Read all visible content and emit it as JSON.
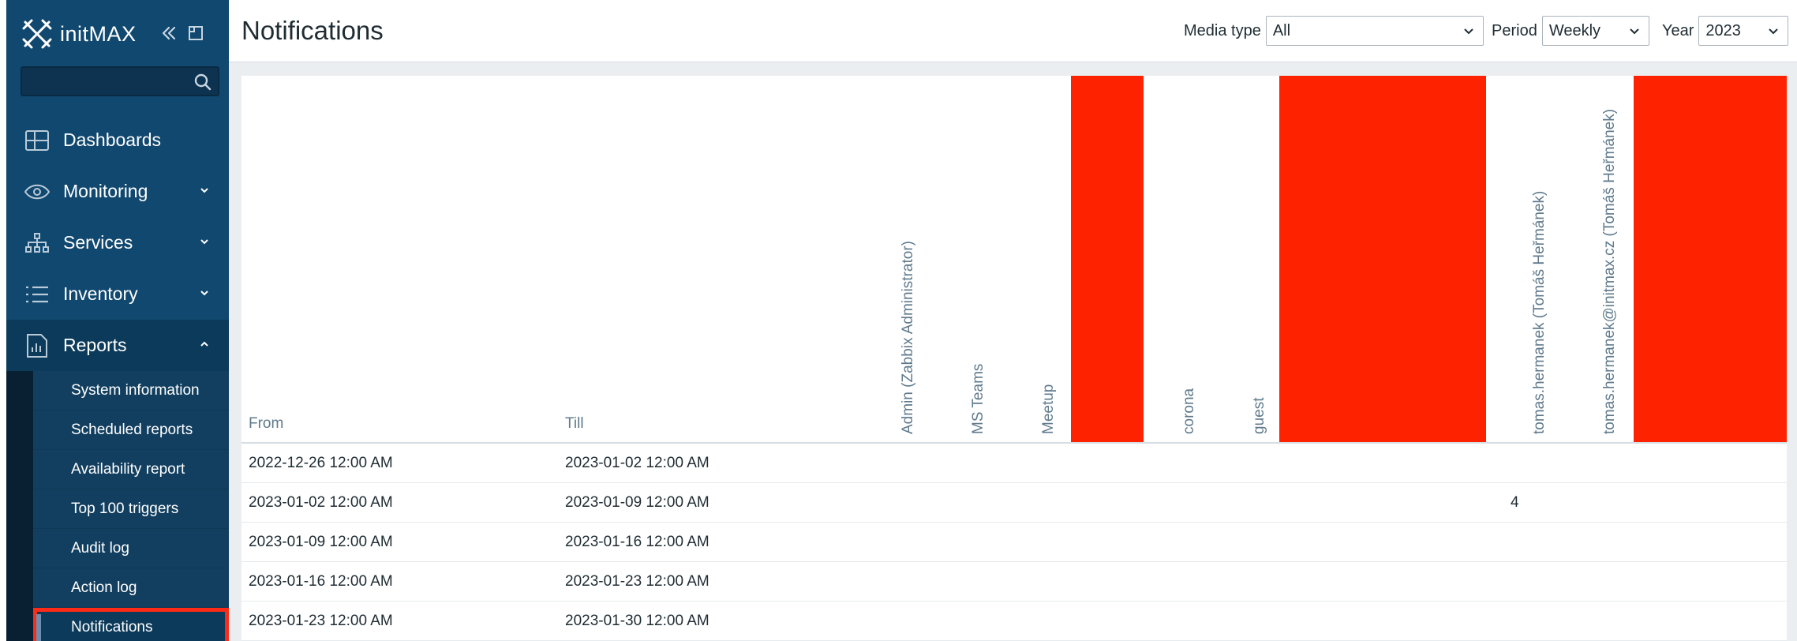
{
  "sidebar": {
    "brand": "initMAX",
    "search_placeholder": "",
    "menu": [
      {
        "label": "Dashboards",
        "icon": "dashboard-icon"
      },
      {
        "label": "Monitoring",
        "icon": "eye-icon"
      },
      {
        "label": "Services",
        "icon": "hierarchy-icon"
      },
      {
        "label": "Inventory",
        "icon": "list-icon"
      },
      {
        "label": "Reports",
        "icon": "report-icon"
      }
    ],
    "reports_submenu": [
      "System information",
      "Scheduled reports",
      "Availability report",
      "Top 100 triggers",
      "Audit log",
      "Action log",
      "Notifications"
    ]
  },
  "header": {
    "title": "Notifications",
    "media_type_label": "Media type",
    "media_type_value": "All",
    "period_label": "Period",
    "period_value": "Weekly",
    "year_label": "Year",
    "year_value": "2023"
  },
  "table": {
    "col_from": "From",
    "col_till": "Till",
    "user_columns": [
      "Admin (Zabbix Administrator)",
      "MS Teams",
      "Meetup",
      "corona",
      "guest",
      "tomas.hermanek (Tomáš Heřmánek)",
      "tomas.hermanek@initmax.cz (Tomáš Heřmánek)"
    ],
    "rows": [
      {
        "from": "2022-12-26 12:00 AM",
        "till": "2023-01-02 12:00 AM",
        "value": ""
      },
      {
        "from": "2023-01-02 12:00 AM",
        "till": "2023-01-09 12:00 AM",
        "value": "4"
      },
      {
        "from": "2023-01-09 12:00 AM",
        "till": "2023-01-16 12:00 AM",
        "value": ""
      },
      {
        "from": "2023-01-16 12:00 AM",
        "till": "2023-01-23 12:00 AM",
        "value": ""
      },
      {
        "from": "2023-01-23 12:00 AM",
        "till": "2023-01-30 12:00 AM",
        "value": ""
      }
    ]
  },
  "colors": {
    "sidebar": "#11486f",
    "highlight": "#ff2200"
  }
}
